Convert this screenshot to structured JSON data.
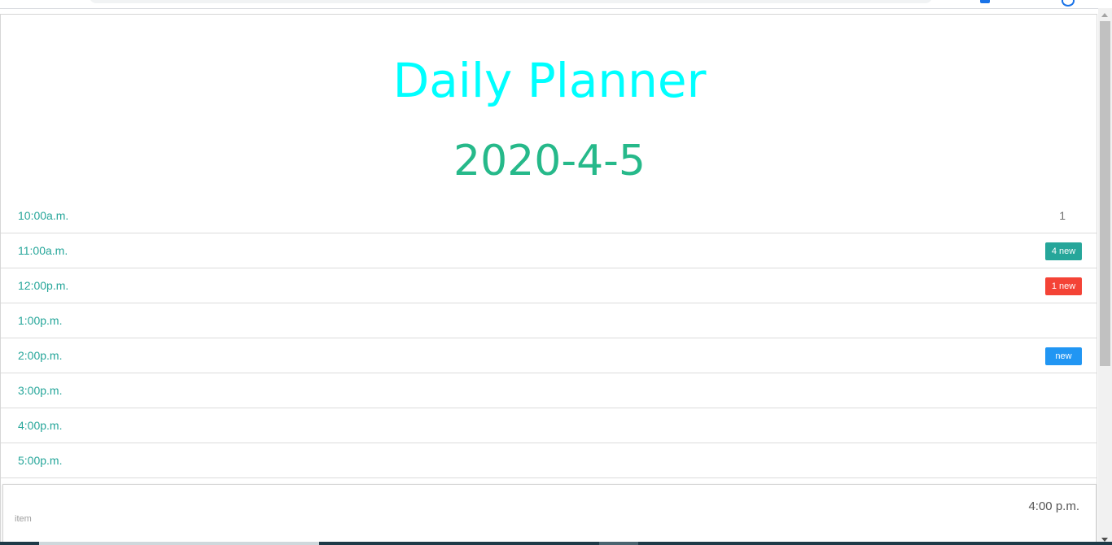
{
  "header": {
    "title": "Daily Planner",
    "date": "2020-4-5"
  },
  "schedule": [
    {
      "time": "10:00a.m.",
      "count": "1"
    },
    {
      "time": "11:00a.m.",
      "badge": "4 new",
      "badge_color": "#26a69a"
    },
    {
      "time": "12:00p.m.",
      "badge": "1 new",
      "badge_color": "#f44336"
    },
    {
      "time": "1:00p.m."
    },
    {
      "time": "2:00p.m.",
      "badge": "new",
      "badge_color": "#2196f3"
    },
    {
      "time": "3:00p.m."
    },
    {
      "time": "4:00p.m."
    },
    {
      "time": "5:00p.m."
    }
  ],
  "input": {
    "time": "4:00 p.m.",
    "label": "item"
  },
  "colors": {
    "title": "#00ffff",
    "date": "#26b98a",
    "time_text": "#26a69a"
  }
}
